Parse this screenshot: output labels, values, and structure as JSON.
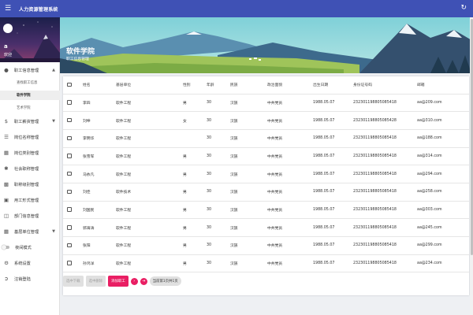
{
  "app": {
    "title": "人力资源管理系统"
  },
  "appbar": {
    "menu_icon": "menu-icon",
    "refresh_icon": "refresh-icon"
  },
  "profile": {
    "avatar_letter": "",
    "name": "a",
    "subtitle": "欢迎"
  },
  "nav": {
    "items": [
      {
        "label": "职工信息管理",
        "icon": "people-icon",
        "expanded": true
      },
      {
        "label": "查找职工信息",
        "sub": true
      },
      {
        "label": "软件学院",
        "sub": true,
        "active": true
      },
      {
        "label": "艺术学院",
        "sub": true
      },
      {
        "label": "职工薪资管理",
        "icon": "dollar-icon",
        "expanded": false
      },
      {
        "label": "岗位名称管理",
        "icon": "list-icon"
      },
      {
        "label": "岗位类别管理",
        "icon": "category-icon"
      },
      {
        "label": "社会职称管理",
        "icon": "social-icon"
      },
      {
        "label": "职称级别管理",
        "icon": "assignment-icon"
      },
      {
        "label": "用工形式管理",
        "icon": "work-icon"
      },
      {
        "label": "部门信息管理",
        "icon": "folder-icon"
      },
      {
        "label": "基层单位管理",
        "icon": "grid-icon",
        "expanded": false
      },
      {
        "label": "夜间模式",
        "icon": "toggle-icon"
      },
      {
        "label": "系统设置",
        "icon": "settings-icon"
      },
      {
        "label": "注销登陆",
        "icon": "logout-icon"
      }
    ]
  },
  "banner": {
    "title": "软件学院",
    "subtitle": "职工信息管理"
  },
  "table": {
    "headers": [
      "姓名",
      "基层单位",
      "性别",
      "年龄",
      "民族",
      "政治面貌",
      "出生日期",
      "身份证号码",
      "邮箱"
    ],
    "rows": [
      [
        "李四",
        "软件工程",
        "男",
        "30",
        "汉族",
        "中共党员",
        "1988.05.07",
        "232301198805085418",
        "aa@209.com"
      ],
      [
        "刘坤",
        "软件工程",
        "女",
        "30",
        "汉族",
        "中共党员",
        "1988.05.07",
        "232301198805085428",
        "aa@310.com"
      ],
      [
        "李明华",
        "软件工程",
        "",
        "30",
        "汉族",
        "中共党员",
        "1988.05.07",
        "232301198805085418",
        "aa@188.com"
      ],
      [
        "张雪军",
        "软件工程",
        "男",
        "30",
        "汉族",
        "中共党员",
        "1988.05.07",
        "232301198805085418",
        "aa@314.com"
      ],
      [
        "马依凡",
        "软件工程",
        "男",
        "30",
        "汉族",
        "中共党员",
        "1988.05.07",
        "232301198805085418",
        "aa@294.com"
      ],
      [
        "刘佳",
        "软件技术",
        "男",
        "30",
        "汉族",
        "中共党员",
        "1988.05.07",
        "232301198805085418",
        "aa@258.com"
      ],
      [
        "刘国民",
        "软件工程",
        "男",
        "30",
        "汉族",
        "中共党员",
        "1988.05.07",
        "232301198805085418",
        "aa@303.com"
      ],
      [
        "郭海涛",
        "软件工程",
        "男",
        "30",
        "汉族",
        "中共党员",
        "1988.05.07",
        "232301198805085418",
        "aa@245.com"
      ],
      [
        "张阳",
        "软件工程",
        "男",
        "30",
        "汉族",
        "中共党员",
        "1988.05.07",
        "232301198805085418",
        "aa@299.com"
      ],
      [
        "孙鸿洋",
        "软件工程",
        "男",
        "30",
        "汉族",
        "中共党员",
        "1988.05.07",
        "232301198805085418",
        "aa@234.com"
      ]
    ]
  },
  "footer": {
    "download_label": "选中下载",
    "delete_label": "选中删除",
    "add_label": "添加职工",
    "next_icon": "chevron-right-icon",
    "last_icon": "last-page-icon",
    "page_info": "当前第1页共1页"
  },
  "colors": {
    "appbar": "#3f51b5",
    "accent": "#e91e63"
  }
}
